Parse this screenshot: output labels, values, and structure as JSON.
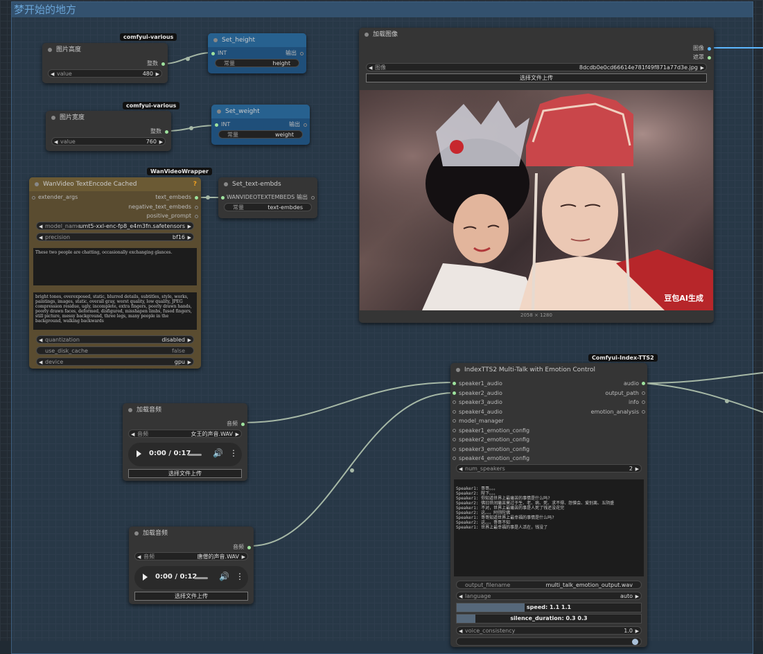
{
  "group_title": "梦开始的地方",
  "nodes": {
    "img_height": {
      "badge": "comfyui-various",
      "title": "图片高度",
      "out_label": "整数",
      "widget_label": "value",
      "widget_value": "480"
    },
    "set_height": {
      "title": "Set_height",
      "in_label": "INT",
      "out_label": "输出",
      "widget_label": "常量",
      "widget_value": "height"
    },
    "img_width": {
      "badge": "comfyui-various",
      "title": "图片宽度",
      "out_label": "整数",
      "widget_label": "value",
      "widget_value": "760"
    },
    "set_weight": {
      "title": "Set_weight",
      "in_label": "INT",
      "out_label": "输出",
      "widget_label": "常量",
      "widget_value": "weight"
    },
    "textencode": {
      "badge": "WanVideoWrapper",
      "title": "WanVideo TextEncode Cached",
      "help": "?",
      "in_label": "extender_args",
      "outputs": [
        "text_embeds",
        "negative_text_embeds",
        "positive_prompt"
      ],
      "model_name_label": "model_name",
      "model_name_value": "umt5-xxl-enc-fp8_e4m3fn.safetensors",
      "precision_label": "precision",
      "precision_value": "bf16",
      "positive_text": "These two people are chatting, occasionally exchanging glances.",
      "negative_text": "bright tones, overexposed, static, blurred details, subtitles, style, works, paintings, images, static, overall gray, worst quality, low quality, JPEG compression residue, ugly, incomplete, extra fingers, poorly drawn hands, poorly drawn faces, deformed, disfigured, misshapen limbs, fused fingers, still picture, messy background, three legs, many people in the background, walking backwards",
      "quantization_label": "quantization",
      "quantization_value": "disabled",
      "disk_cache_label": "use_disk_cache",
      "disk_cache_value": "false",
      "device_label": "device",
      "device_value": "gpu"
    },
    "set_text": {
      "title": "Set_text-embds",
      "in_label": "WANVIDEOTEXTEMBEDS",
      "out_label": "输出",
      "widget_label": "常量",
      "widget_value": "text-embdes"
    },
    "load_image": {
      "title": "加载图像",
      "outputs": [
        "图像",
        "遮罩"
      ],
      "image_label": "图像",
      "image_value": "8dcdb0e0cd66614e781f49f871a77d3e.jpg",
      "upload_label": "选择文件上传",
      "watermark": "豆包AI生成",
      "size_label": "2058 × 1280"
    },
    "load_audio1": {
      "title": "加载音频",
      "out_label": "音频",
      "audio_label": "音频",
      "audio_value": "女王的声音.WAV",
      "time": "0:00 / 0:17",
      "upload_label": "选择文件上传"
    },
    "load_audio2": {
      "title": "加载音频",
      "out_label": "音频",
      "audio_label": "音频",
      "audio_value": "唐僧的声音.WAV",
      "time": "0:00 / 0:12",
      "upload_label": "选择文件上传"
    },
    "tts": {
      "badge": "Comfyui-Index-TTS2",
      "title": "IndexTTS2 Multi-Talk with Emotion Control",
      "inputs": [
        "speaker1_audio",
        "speaker2_audio",
        "speaker3_audio",
        "speaker4_audio",
        "model_manager",
        "speaker1_emotion_config",
        "speaker2_emotion_config",
        "speaker3_emotion_config",
        "speaker4_emotion_config"
      ],
      "outputs": [
        "audio",
        "output_path",
        "info",
        "emotion_analysis"
      ],
      "num_speakers_label": "num_speakers",
      "num_speakers_value": "2",
      "script": "Speaker1: 哥哥。。。\nSpeaker2: 陛下。。。\nSpeaker1: 你知道世界上最痛苦的事情是什么吗?\nSpeaker2: 佛曰世间痛苦莫过于生、老、病、死、求不得、怨憎会、爱别离、五阴盛\nSpeaker1: 不对，世界上最痛苦的事是人死了钱还没花完\nSpeaker2: 这。。。阿弥陀佛\nSpeaker1: 哥哥知道世界上最幸福的事情是什么吗?\nSpeaker2: 这。。。哥哥不知\nSpeaker1: 世界上最幸福的事是人活在，钱没了",
      "filename_label": "output_filename",
      "filename_value": "multi_talk_emotion_output.wav",
      "language_label": "language",
      "language_value": "auto",
      "speed_label": "speed: 1.1  1.1",
      "speed_fill": 0.37,
      "silence_label": "silence_duration: 0.3  0.3",
      "silence_fill": 0.1,
      "consistency_label": "voice_consistency",
      "consistency_value": "1.0"
    }
  }
}
